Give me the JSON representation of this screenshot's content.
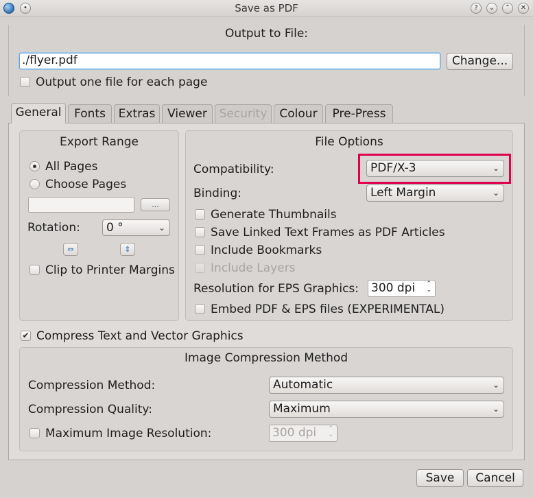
{
  "window": {
    "title": "Save as PDF"
  },
  "output": {
    "heading": "Output to File:",
    "file_value": "./flyer.pdf",
    "change_label": "Change...",
    "one_file_label": "Output one file for each page"
  },
  "tabs": [
    {
      "label": "General"
    },
    {
      "label": "Fonts"
    },
    {
      "label": "Extras"
    },
    {
      "label": "Viewer"
    },
    {
      "label": "Security"
    },
    {
      "label": "Colour"
    },
    {
      "label": "Pre-Press"
    }
  ],
  "export_range": {
    "heading": "Export Range",
    "all_pages": "All Pages",
    "choose_pages": "Choose Pages",
    "pages_value": "",
    "browse_label": "...",
    "rotation_label": "Rotation:",
    "rotation_value": "0 °",
    "clip_label": "Clip to Printer Margins"
  },
  "file_options": {
    "heading": "File Options",
    "compat_label": "Compatibility:",
    "compat_value": "PDF/X-3",
    "binding_label": "Binding:",
    "binding_value": "Left Margin",
    "thumbnails": "Generate Thumbnails",
    "linked_frames": "Save Linked Text Frames as PDF Articles",
    "bookmarks": "Include Bookmarks",
    "layers": "Include Layers",
    "eps_res_label": "Resolution for EPS Graphics:",
    "eps_res_value": "300 dpi",
    "embed_label": "Embed PDF & EPS files (EXPERIMENTAL)"
  },
  "compress": {
    "label": "Compress Text and Vector Graphics",
    "heading": "Image Compression Method",
    "method_label": "Compression Method:",
    "method_value": "Automatic",
    "quality_label": "Compression Quality:",
    "quality_value": "Maximum",
    "max_res_label": "Maximum Image Resolution:",
    "max_res_value": "300 dpi"
  },
  "footer": {
    "save_label": "Save",
    "cancel_label": "Cancel"
  },
  "colors": {
    "highlight": "#e0004e",
    "window_bg": "#d6d2d0"
  }
}
